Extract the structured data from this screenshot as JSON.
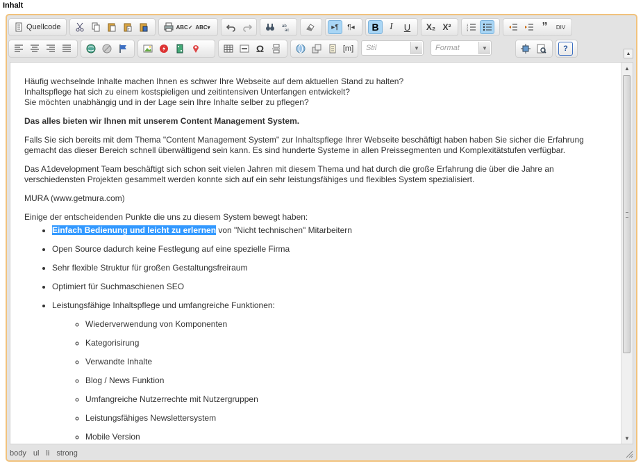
{
  "field_label": "Inhalt",
  "toolbar": {
    "source_label": "Quellcode",
    "style_combo": "Stil",
    "format_combo": "Format",
    "help_label": "?",
    "sub_label": "X₂",
    "sup_label": "X²",
    "bold_label": "B",
    "italic_label": "I",
    "underline_label": "U",
    "omega_label": "Ω",
    "placeholder_label": "[m]"
  },
  "content": {
    "p1_lines": [
      "Häufig wechselnde Inhalte machen Ihnen es schwer Ihre Webseite auf dem aktuellen Stand zu halten?",
      "Inhaltspflege hat sich zu einem kostspieligen und zeitintensiven Unterfangen entwickelt?",
      "Sie möchten unabhängig und in der Lage sein Ihre Inhalte selber zu pflegen?"
    ],
    "strong_heading": "Das alles bieten wir Ihnen mit unserem Content Management System.",
    "p2": "Falls Sie sich bereits mit dem Thema \"Content Management System\" zur Inhaltspflege Ihrer Webseite beschäftigt haben haben Sie sicher die Erfahrung gemacht das dieser Bereich schnell überwältigend sein kann. Es sind hunderte Systeme in allen Preissegmenten und Komplexitätstufen verfügbar.",
    "p3": "Das A1development Team beschäftigt sich schon seit vielen Jahren mit diesem Thema und hat durch die große Erfahrung die über die Jahre an verschiedensten Projekten gesammelt werden konnte sich auf ein sehr leistungsfähiges und flexibles System spezialisiert.",
    "p4": "MURA (www.getmura.com)",
    "p5": "Einige der entscheidenden Punkte die uns zu diesem System bewegt haben:",
    "list": {
      "item1_selected": "Einfach Bedienung und leicht zu erlernen",
      "item1_rest": " von \"Nicht technischen\" Mitarbeitern",
      "item2": "Open Source dadurch keine Festlegung auf eine spezielle Firma",
      "item3": "Sehr flexible Struktur für großen Gestaltungsfreiraum",
      "item4": "Optimiert für Suchmaschienen SEO",
      "item5": "Leistungsfähige Inhaltspflege und umfangreiche Funktionen:",
      "subitems": [
        "Wiederverwendung von Komponenten",
        "Kategorisirung",
        "Verwandte Inhalte",
        "Blog / News Funktion",
        "Umfangreiche Nutzerrechte mit Nutzergruppen",
        "Leistungsfähiges Newslettersystem",
        "Mobile Version"
      ]
    }
  },
  "statusbar": {
    "path": [
      "body",
      "ul",
      "li",
      "strong"
    ]
  },
  "colors": {
    "border_accent": "#f1c27d",
    "selection": "#3399ff",
    "active_button": "#a9d6f5"
  }
}
